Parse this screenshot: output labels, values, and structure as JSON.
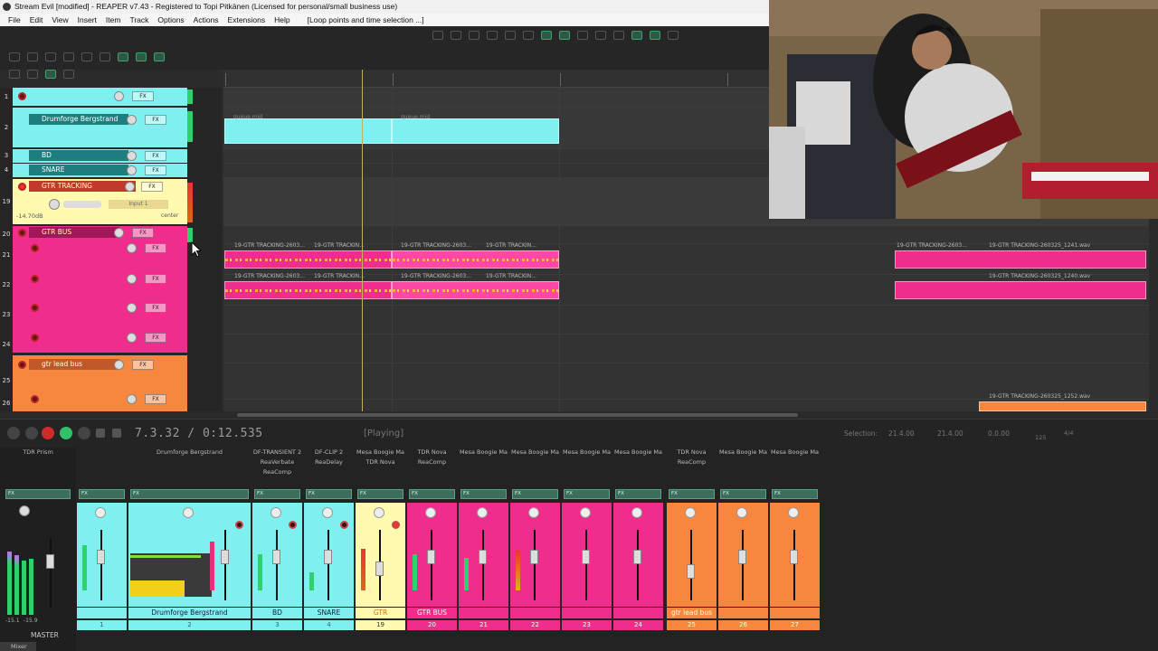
{
  "window": {
    "title": "Stream Evil [modified] - REAPER v7.43 - Registered to Topi Pitkänen (Licensed for personal/small business use)"
  },
  "menu": [
    "File",
    "Edit",
    "View",
    "Insert",
    "Item",
    "Track",
    "Options",
    "Actions",
    "Extensions",
    "Help",
    "[Loop points and time selection ...]"
  ],
  "tracks": [
    {
      "num": "1",
      "name": "",
      "color": "#7ff0f0"
    },
    {
      "num": "2",
      "name": "Drumforge Bergstrand",
      "color": "#7ff0f0"
    },
    {
      "num": "3",
      "name": "BD",
      "color": "#7ff0f0"
    },
    {
      "num": "4",
      "name": "SNARE",
      "color": "#7ff0f0"
    },
    {
      "num": "19",
      "name": "GTR TRACKING",
      "color": "#fffab0",
      "volume": "-14.70dB",
      "input": "Input 1",
      "pan": "center"
    },
    {
      "num": "20",
      "name": "GTR BUS",
      "color": "#f02c8c"
    },
    {
      "num": "21",
      "name": "",
      "color": "#f02c8c"
    },
    {
      "num": "22",
      "name": "",
      "color": "#f02c8c"
    },
    {
      "num": "23",
      "name": "",
      "color": "#f02c8c"
    },
    {
      "num": "24",
      "name": "",
      "color": "#f02c8c"
    },
    {
      "num": "25",
      "name": "gtr lead bus",
      "color": "#f7873f"
    },
    {
      "num": "26",
      "name": "",
      "color": "#f7873f"
    }
  ],
  "items": {
    "midi_a": "queue.mid",
    "midi_b": "queue.mid",
    "gtr_a": "19-GTR TRACKING-2603...",
    "gtr_b": "19-GTR TRACKIN...",
    "gtr_c": "19-GTR TRACKING-2603...",
    "gtr_d": "19-GTR TRACKIN...",
    "gtr_far1": "19-GTR TRACKING-2603...",
    "gtr_far2": "19-GTR TRACKING-260325_1241.wav",
    "gtr_far3": "19-GTR TRACKING-260325_1240.wav",
    "gtr_far4": "19-GTR TRACKING-260325_1252.wav"
  },
  "transport": {
    "time": "7.3.32 / 0:12.535",
    "status": "[Playing]",
    "selection_label": "Selection:",
    "sel_start": "21.4.00",
    "sel_end": "21.4.00",
    "sel_len": "0.0.00",
    "bpm": "125",
    "sig": "4/4"
  },
  "mixer": {
    "master_label": "MASTER",
    "master_db_l": "-15.1",
    "master_db_r": "-15.9",
    "master_fx": "TDR Prism",
    "tab": "Mixer",
    "strips": [
      {
        "num": "1",
        "name": "",
        "fx": "",
        "color": "#7ff0f0"
      },
      {
        "num": "2",
        "name": "Drumforge Bergstrand",
        "fx": "Drumforge Bergstrand",
        "color": "#7ff0f0"
      },
      {
        "num": "3",
        "name": "BD",
        "fx": "DF-TRANSIENT 2\nReaVerbate\nReaComp",
        "color": "#7ff0f0"
      },
      {
        "num": "4",
        "name": "SNARE",
        "fx": "DF-CLIP 2\nReaDelay",
        "color": "#7ff0f0"
      },
      {
        "num": "19",
        "name": "GTR TRACKING",
        "fx": "Mesa Boogie Ma\nTDR Nova",
        "color": "#fffab0"
      },
      {
        "num": "20",
        "name": "GTR BUS",
        "fx": "TDR Nova\nReaComp",
        "color": "#f02c8c"
      },
      {
        "num": "21",
        "name": "",
        "fx": "Mesa Boogie Ma",
        "color": "#f02c8c"
      },
      {
        "num": "22",
        "name": "",
        "fx": "Mesa Boogie Ma",
        "color": "#f02c8c"
      },
      {
        "num": "23",
        "name": "",
        "fx": "Mesa Boogie Ma",
        "color": "#f02c8c"
      },
      {
        "num": "24",
        "name": "",
        "fx": "Mesa Boogie Ma",
        "color": "#f02c8c"
      },
      {
        "num": "25",
        "name": "gtr lead bus",
        "fx": "TDR Nova\nReaComp",
        "color": "#f7873f"
      },
      {
        "num": "26",
        "name": "",
        "fx": "Mesa Boogie Ma",
        "color": "#f7873f"
      },
      {
        "num": "27",
        "name": "",
        "fx": "Mesa Boogie Ma",
        "color": "#f7873f"
      }
    ]
  },
  "colors": {
    "cyan": "#7ff0f0",
    "pink": "#f02c8c",
    "orange": "#f7873f",
    "yellow": "#fffab0"
  }
}
